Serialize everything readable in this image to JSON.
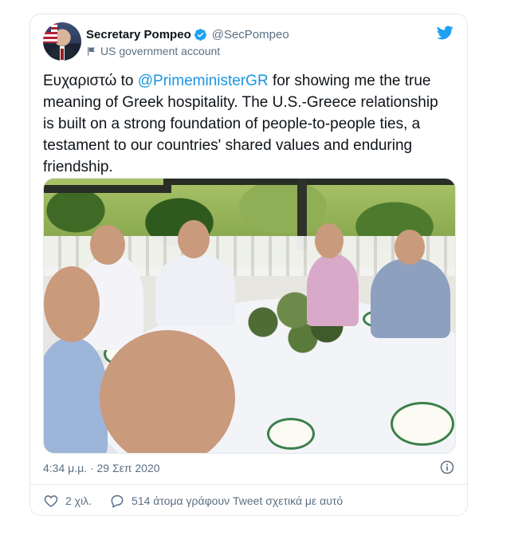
{
  "tweet": {
    "author": {
      "display_name": "Secretary Pompeo",
      "handle": "@SecPompeo",
      "label": "US government account"
    },
    "text_before": "Ευχαριστώ to ",
    "mention": "@PrimeministerGR",
    "text_after": " for showing me the true meaning of Greek hospitality. The U.S.-Greece relationship is built on a strong foundation of people-to-people ties, a testament to our countries' shared values and enduring friendship.",
    "timestamp": "4:34 μ.μ. · 29 Σεπ 2020",
    "likes_label": "2 χιλ.",
    "replies_label": "514 άτομα γράφουν Tweet σχετικά με αυτό"
  },
  "colors": {
    "brand": "#1da1f2",
    "mention": "#1b95e0",
    "secondary_text": "#5b7083"
  },
  "icons": {
    "verified": "verified-badge-icon",
    "government": "flag-icon",
    "logo": "twitter-bird-icon",
    "info": "info-icon",
    "like": "heart-icon",
    "reply": "speech-bubble-icon"
  }
}
